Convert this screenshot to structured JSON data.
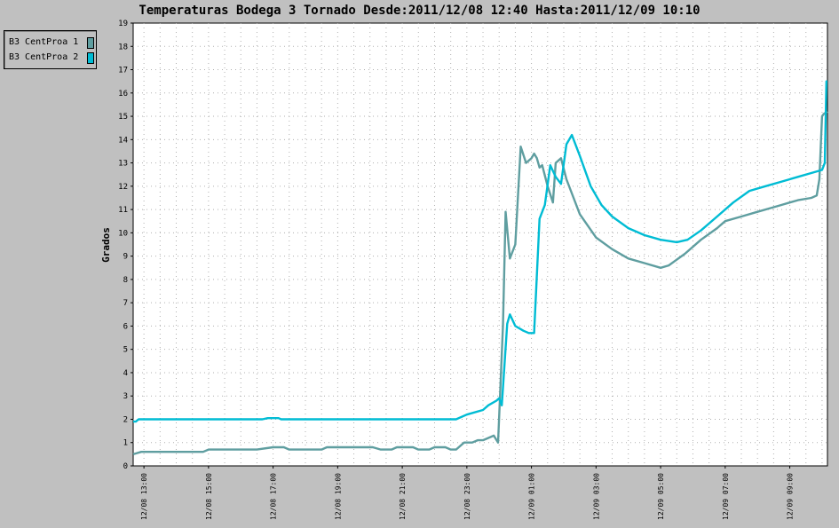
{
  "chart_data": {
    "type": "line",
    "title": "Temperaturas Bodega 3 Tornado Desde:2011/12/08 12:40 Hasta:2011/12/09 10:10",
    "ylabel": "Grados",
    "xlabel": "",
    "ylim": [
      0,
      19
    ],
    "yticks": [
      0,
      1,
      2,
      3,
      4,
      5,
      6,
      7,
      8,
      9,
      10,
      11,
      12,
      13,
      14,
      15,
      16,
      17,
      18,
      19
    ],
    "xlim": [
      "12/08 12:40",
      "12/09 10:10"
    ],
    "xticks": [
      "12/08 13:00",
      "12/08 15:00",
      "12/08 17:00",
      "12/08 19:00",
      "12/08 21:00",
      "12/08 23:00",
      "12/09 01:00",
      "12/09 03:00",
      "12/09 05:00",
      "12/09 07:00",
      "12/09 09:00"
    ],
    "grid": true,
    "legend_position": "top-left",
    "series": [
      {
        "name": "B3 CentProa 1",
        "color": "#5f9ea0",
        "points": [
          [
            "12/08 12:40",
            0.5
          ],
          [
            "12/08 12:55",
            0.6
          ],
          [
            "12/08 14:00",
            0.6
          ],
          [
            "12/08 14:50",
            0.6
          ],
          [
            "12/08 15:00",
            0.7
          ],
          [
            "12/08 16:30",
            0.7
          ],
          [
            "12/08 17:00",
            0.8
          ],
          [
            "12/08 17:20",
            0.8
          ],
          [
            "12/08 17:30",
            0.7
          ],
          [
            "12/08 18:30",
            0.7
          ],
          [
            "12/08 18:40",
            0.8
          ],
          [
            "12/08 20:05",
            0.8
          ],
          [
            "12/08 20:20",
            0.7
          ],
          [
            "12/08 20:40",
            0.7
          ],
          [
            "12/08 20:50",
            0.8
          ],
          [
            "12/08 21:20",
            0.8
          ],
          [
            "12/08 21:30",
            0.7
          ],
          [
            "12/08 21:50",
            0.7
          ],
          [
            "12/08 22:00",
            0.8
          ],
          [
            "12/08 22:20",
            0.8
          ],
          [
            "12/08 22:30",
            0.7
          ],
          [
            "12/08 22:40",
            0.7
          ],
          [
            "12/08 22:55",
            1.0
          ],
          [
            "12/08 23:10",
            1.0
          ],
          [
            "12/08 23:20",
            1.1
          ],
          [
            "12/08 23:30",
            1.1
          ],
          [
            "12/08 23:40",
            1.2
          ],
          [
            "12/08 23:50",
            1.3
          ],
          [
            "12/08 23:58",
            1.0
          ],
          [
            "12/09 00:07",
            6.0
          ],
          [
            "12/09 00:12",
            10.9
          ],
          [
            "12/09 00:20",
            8.9
          ],
          [
            "12/09 00:30",
            9.5
          ],
          [
            "12/09 00:40",
            13.7
          ],
          [
            "12/09 00:50",
            13.0
          ],
          [
            "12/09 01:00",
            13.2
          ],
          [
            "12/09 01:05",
            13.4
          ],
          [
            "12/09 01:10",
            13.2
          ],
          [
            "12/09 01:15",
            12.8
          ],
          [
            "12/09 01:20",
            12.9
          ],
          [
            "12/09 01:30",
            12.0
          ],
          [
            "12/09 01:40",
            11.3
          ],
          [
            "12/09 01:45",
            13.0
          ],
          [
            "12/09 01:55",
            13.2
          ],
          [
            "12/09 02:05",
            12.3
          ],
          [
            "12/09 02:30",
            10.8
          ],
          [
            "12/09 03:00",
            9.8
          ],
          [
            "12/09 03:30",
            9.3
          ],
          [
            "12/09 04:00",
            8.9
          ],
          [
            "12/09 04:30",
            8.7
          ],
          [
            "12/09 05:00",
            8.5
          ],
          [
            "12/09 05:15",
            8.6
          ],
          [
            "12/09 05:45",
            9.1
          ],
          [
            "12/09 06:15",
            9.7
          ],
          [
            "12/09 06:45",
            10.2
          ],
          [
            "12/09 07:00",
            10.5
          ],
          [
            "12/09 07:30",
            10.7
          ],
          [
            "12/09 08:00",
            10.9
          ],
          [
            "12/09 08:30",
            11.1
          ],
          [
            "12/09 08:45",
            11.2
          ],
          [
            "12/09 09:00",
            11.3
          ],
          [
            "12/09 09:15",
            11.4
          ],
          [
            "12/09 09:40",
            11.5
          ],
          [
            "12/09 09:50",
            11.6
          ],
          [
            "12/09 09:55",
            12.3
          ],
          [
            "12/09 10:00",
            15.0
          ],
          [
            "12/09 10:03",
            15.1
          ],
          [
            "12/09 10:10",
            15.2
          ]
        ]
      },
      {
        "name": "B3 CentProa 2",
        "color": "#00bcd4",
        "points": [
          [
            "12/08 12:40",
            1.9
          ],
          [
            "12/08 12:45",
            1.9
          ],
          [
            "12/08 12:50",
            2.0
          ],
          [
            "12/08 16:40",
            2.0
          ],
          [
            "12/08 16:50",
            2.05
          ],
          [
            "12/08 17:10",
            2.05
          ],
          [
            "12/08 17:15",
            2.0
          ],
          [
            "12/08 22:40",
            2.0
          ],
          [
            "12/08 23:00",
            2.2
          ],
          [
            "12/08 23:30",
            2.4
          ],
          [
            "12/08 23:40",
            2.6
          ],
          [
            "12/08 23:55",
            2.8
          ],
          [
            "12/09 00:00",
            2.9
          ],
          [
            "12/09 00:05",
            2.6
          ],
          [
            "12/09 00:15",
            6.1
          ],
          [
            "12/09 00:20",
            6.5
          ],
          [
            "12/09 00:30",
            6.0
          ],
          [
            "12/09 00:45",
            5.8
          ],
          [
            "12/09 00:55",
            5.7
          ],
          [
            "12/09 01:05",
            5.7
          ],
          [
            "12/09 01:15",
            10.6
          ],
          [
            "12/09 01:25",
            11.2
          ],
          [
            "12/09 01:35",
            12.9
          ],
          [
            "12/09 01:45",
            12.4
          ],
          [
            "12/09 01:55",
            12.1
          ],
          [
            "12/09 02:05",
            13.8
          ],
          [
            "12/09 02:15",
            14.2
          ],
          [
            "12/09 02:30",
            13.3
          ],
          [
            "12/09 02:50",
            12.0
          ],
          [
            "12/09 03:10",
            11.2
          ],
          [
            "12/09 03:30",
            10.7
          ],
          [
            "12/09 04:00",
            10.2
          ],
          [
            "12/09 04:30",
            9.9
          ],
          [
            "12/09 05:00",
            9.7
          ],
          [
            "12/09 05:30",
            9.6
          ],
          [
            "12/09 05:50",
            9.7
          ],
          [
            "12/09 06:15",
            10.1
          ],
          [
            "12/09 06:45",
            10.7
          ],
          [
            "12/09 07:15",
            11.3
          ],
          [
            "12/09 07:45",
            11.8
          ],
          [
            "12/09 08:15",
            12.0
          ],
          [
            "12/09 08:45",
            12.2
          ],
          [
            "12/09 09:15",
            12.4
          ],
          [
            "12/09 09:45",
            12.6
          ],
          [
            "12/09 10:00",
            12.7
          ],
          [
            "12/09 10:05",
            13.0
          ],
          [
            "12/09 10:08",
            16.5
          ],
          [
            "12/09 10:10",
            16.5
          ]
        ]
      }
    ]
  }
}
